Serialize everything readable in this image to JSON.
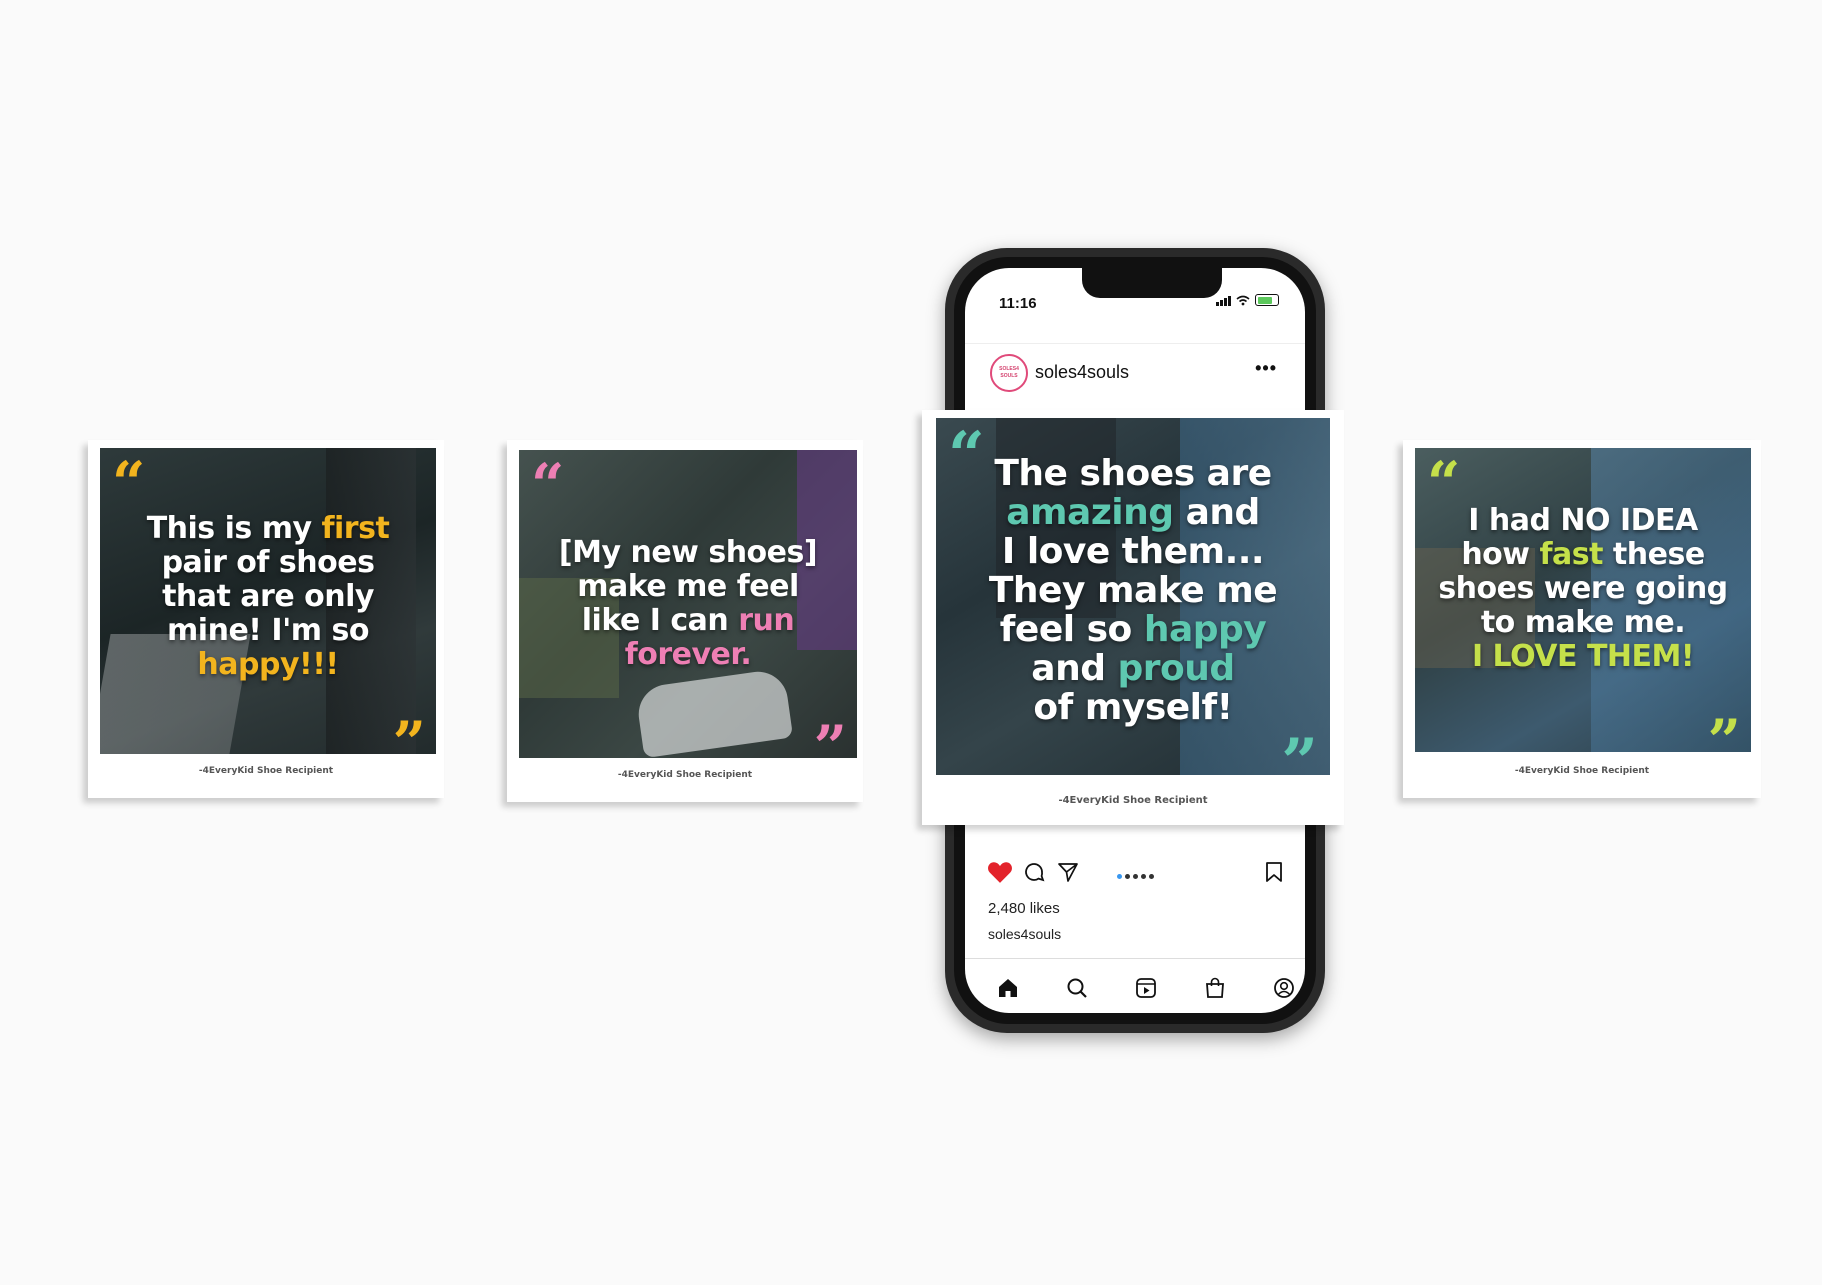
{
  "colors": {
    "yellow": "#f2b41e",
    "pink": "#ee7fb4",
    "teal": "#5ec8b0",
    "lime": "#c5e04a",
    "heart": "#e3232b"
  },
  "cards": [
    {
      "lines": [
        [
          {
            "t": "This is my "
          },
          {
            "t": "first",
            "c": "yellow"
          }
        ],
        [
          {
            "t": "pair of shoes"
          }
        ],
        [
          {
            "t": "that are only"
          }
        ],
        [
          {
            "t": "mine! I'm so"
          }
        ],
        [
          {
            "t": "happy!!!",
            "c": "yellow"
          }
        ]
      ],
      "caption": "-4EveryKid Shoe Recipient",
      "accent": "yellow"
    },
    {
      "lines": [
        [
          {
            "t": "[My new shoes]"
          }
        ],
        [
          {
            "t": "make me feel"
          }
        ],
        [
          {
            "t": "like I can "
          },
          {
            "t": "run",
            "c": "pink"
          }
        ],
        [
          {
            "t": "forever.",
            "c": "pink"
          }
        ]
      ],
      "caption": "-4EveryKid Shoe Recipient",
      "accent": "pink"
    },
    {
      "lines": [
        [
          {
            "t": "The shoes are"
          }
        ],
        [
          {
            "t": "amazing",
            "c": "teal"
          },
          {
            "t": " and"
          }
        ],
        [
          {
            "t": "I love them..."
          }
        ],
        [
          {
            "t": "They make me"
          }
        ],
        [
          {
            "t": "feel so "
          },
          {
            "t": "happy",
            "c": "teal"
          }
        ],
        [
          {
            "t": "and "
          },
          {
            "t": "proud",
            "c": "teal"
          }
        ],
        [
          {
            "t": "of myself!"
          }
        ]
      ],
      "caption": "-4EveryKid Shoe Recipient",
      "accent": "teal"
    },
    {
      "lines": [
        [
          {
            "t": "I had NO IDEA"
          }
        ],
        [
          {
            "t": "how "
          },
          {
            "t": "fast",
            "c": "lime"
          },
          {
            "t": " these"
          }
        ],
        [
          {
            "t": "shoes were going"
          }
        ],
        [
          {
            "t": "to make me."
          }
        ],
        [
          {
            "t": "I LOVE THEM!",
            "c": "lime"
          }
        ]
      ],
      "caption": "-4EveryKid Shoe Recipient",
      "accent": "lime"
    }
  ],
  "phone": {
    "time": "11:16",
    "username": "soles4souls",
    "avatar_text": "SOLES4 SOULS",
    "more": "•••",
    "likes": "2,480 likes",
    "owner": "soles4souls",
    "icons": [
      "heart-icon",
      "comment-icon",
      "share-icon",
      "bookmark-icon"
    ],
    "tabs": [
      "home-icon",
      "search-icon",
      "reels-icon",
      "shop-icon",
      "profile-icon"
    ]
  }
}
